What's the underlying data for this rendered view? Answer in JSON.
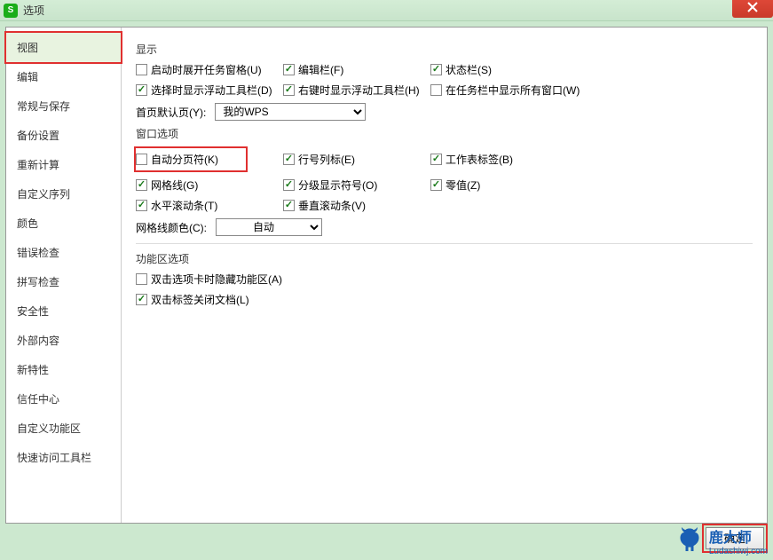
{
  "window": {
    "title": "选项",
    "app_icon_letter": "S"
  },
  "sidebar": {
    "items": [
      {
        "label": "视图",
        "active": true
      },
      {
        "label": "编辑"
      },
      {
        "label": "常规与保存"
      },
      {
        "label": "备份设置"
      },
      {
        "label": "重新计算"
      },
      {
        "label": "自定义序列"
      },
      {
        "label": "颜色"
      },
      {
        "label": "错误检查"
      },
      {
        "label": "拼写检查"
      },
      {
        "label": "安全性"
      },
      {
        "label": "外部内容"
      },
      {
        "label": "新特性"
      },
      {
        "label": "信任中心"
      },
      {
        "label": "自定义功能区"
      },
      {
        "label": "快速访问工具栏"
      }
    ]
  },
  "sections": {
    "display": {
      "title": "显示",
      "startup_taskpane": {
        "label": "启动时展开任务窗格(U)",
        "checked": false
      },
      "edit_bar": {
        "label": "编辑栏(F)",
        "checked": true
      },
      "status_bar": {
        "label": "状态栏(S)",
        "checked": true
      },
      "show_float_toolbar": {
        "label": "选择时显示浮动工具栏(D)",
        "checked": true
      },
      "rightclick_float_toolbar": {
        "label": "右键时显示浮动工具栏(H)",
        "checked": true
      },
      "show_all_taskbar": {
        "label": "在任务栏中显示所有窗口(W)",
        "checked": false
      },
      "default_page_label": "首页默认页(Y):",
      "default_page_value": "我的WPS"
    },
    "window_opts": {
      "title": "窗口选项",
      "auto_page_break": {
        "label": "自动分页符(K)",
        "checked": false,
        "highlighted": true
      },
      "row_col_header": {
        "label": "行号列标(E)",
        "checked": true
      },
      "sheet_tabs": {
        "label": "工作表标签(B)",
        "checked": true
      },
      "gridlines": {
        "label": "网格线(G)",
        "checked": true
      },
      "outline_symbols": {
        "label": "分级显示符号(O)",
        "checked": true
      },
      "zero_values": {
        "label": "零值(Z)",
        "checked": true
      },
      "h_scrollbar": {
        "label": "水平滚动条(T)",
        "checked": true
      },
      "v_scrollbar": {
        "label": "垂直滚动条(V)",
        "checked": true
      },
      "gridline_color_label": "网格线颜色(C):",
      "gridline_color_value": "自动"
    },
    "ribbon_opts": {
      "title": "功能区选项",
      "dblclick_hide": {
        "label": "双击选项卡时隐藏功能区(A)",
        "checked": false
      },
      "dblclick_close": {
        "label": "双击标签关闭文档(L)",
        "checked": true
      }
    }
  },
  "buttons": {
    "ok": "确定"
  },
  "watermark": {
    "brand": "鹿大师",
    "url": "Ludashiwj.com"
  }
}
